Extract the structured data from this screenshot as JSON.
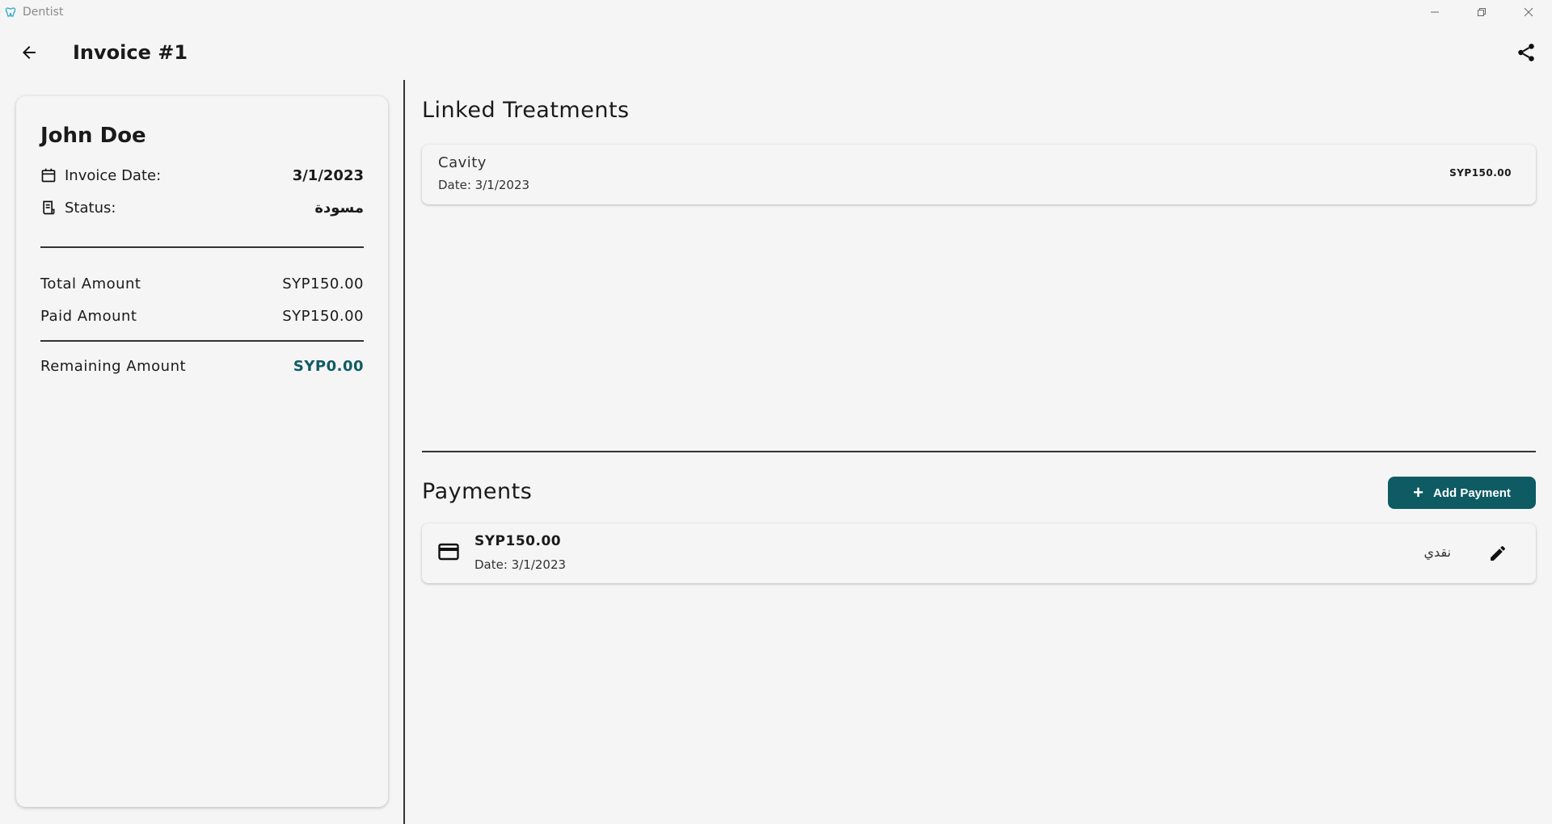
{
  "window": {
    "app_title": "Dentist"
  },
  "header": {
    "title": "Invoice #1"
  },
  "invoice_card": {
    "patient_name": "John Doe",
    "invoice_date_label": "Invoice Date:",
    "invoice_date_value": "3/1/2023",
    "status_label": "Status:",
    "status_value": "مسودة",
    "total_label": "Total Amount",
    "total_value": "SYP150.00",
    "paid_label": "Paid Amount",
    "paid_value": "SYP150.00",
    "remaining_label": "Remaining Amount",
    "remaining_value": "SYP0.00"
  },
  "linked_treatments": {
    "title": "Linked Treatments",
    "items": [
      {
        "name": "Cavity",
        "date": "Date: 3/1/2023",
        "amount": "SYP150.00"
      }
    ]
  },
  "payments": {
    "title": "Payments",
    "add_label": "Add Payment",
    "items": [
      {
        "amount": "SYP150.00",
        "date": "Date: 3/1/2023",
        "method": "نقدي"
      }
    ]
  },
  "colors": {
    "accent": "#0f5b63",
    "background": "#f5f5f5"
  }
}
